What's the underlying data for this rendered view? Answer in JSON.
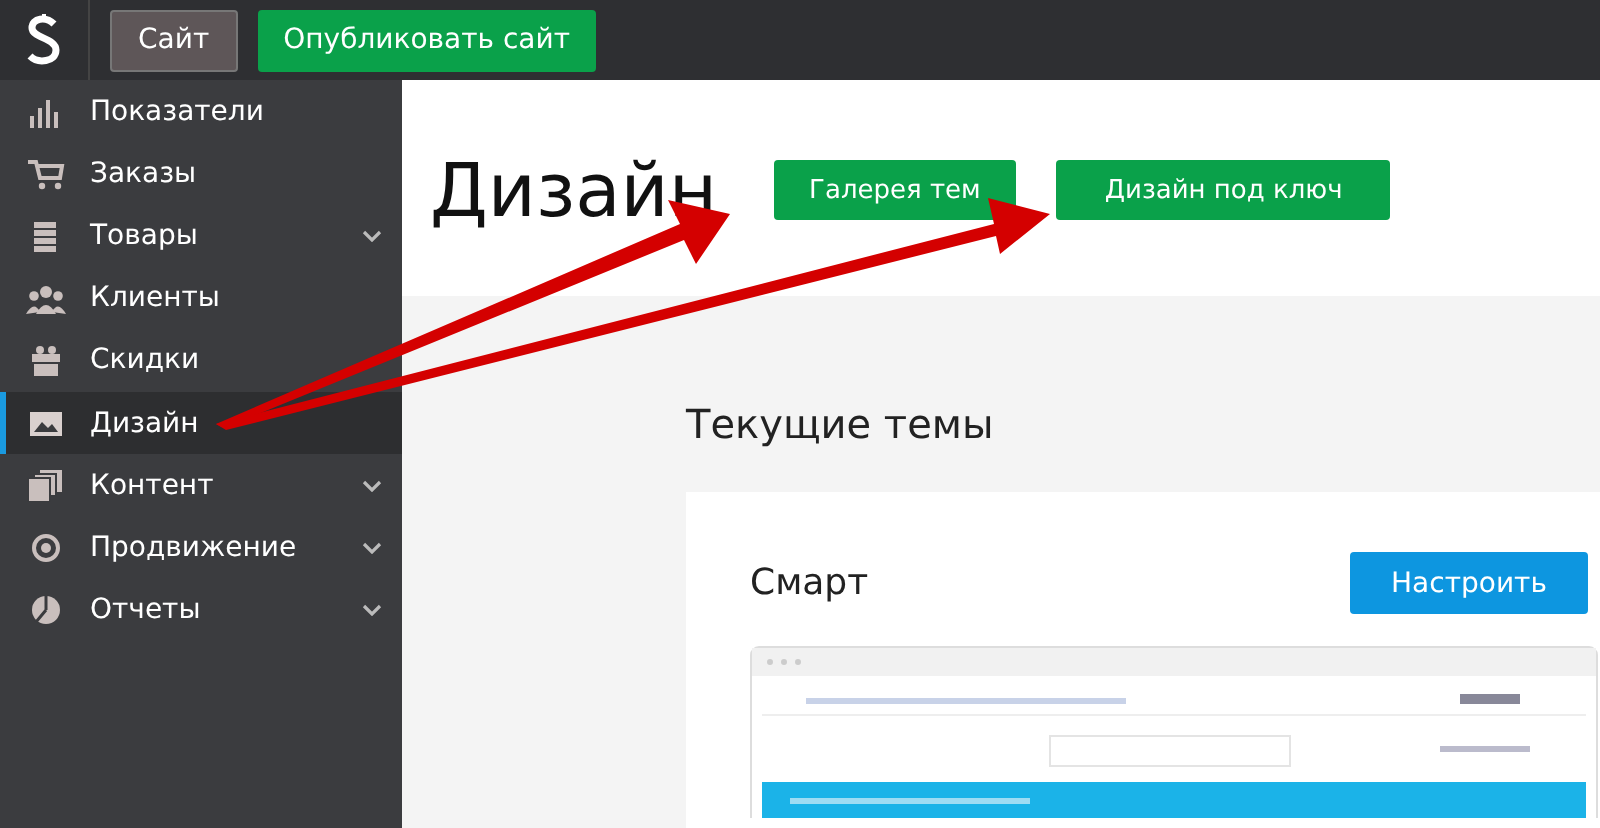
{
  "topbar": {
    "buttons": [
      {
        "label": "Сайт",
        "kind": "plain"
      },
      {
        "label": "Опубликовать сайт",
        "kind": "primary"
      }
    ]
  },
  "sidebar": {
    "items": [
      {
        "label": "Показатели",
        "expandable": false,
        "selected": false
      },
      {
        "label": "Заказы",
        "expandable": false,
        "selected": false
      },
      {
        "label": "Товары",
        "expandable": true,
        "selected": false
      },
      {
        "label": "Клиенты",
        "expandable": false,
        "selected": false
      },
      {
        "label": "Скидки",
        "expandable": false,
        "selected": false
      },
      {
        "label": "Дизайн",
        "expandable": false,
        "selected": true
      },
      {
        "label": "Контент",
        "expandable": true,
        "selected": false
      },
      {
        "label": "Продвижение",
        "expandable": true,
        "selected": false
      },
      {
        "label": "Отчеты",
        "expandable": true,
        "selected": false
      }
    ]
  },
  "page": {
    "title": "Дизайн",
    "buttons": [
      "Галерея тем",
      "Дизайн под ключ"
    ],
    "section_title": "Текущие темы",
    "theme": {
      "name": "Смарт",
      "button": "Настроить"
    }
  }
}
